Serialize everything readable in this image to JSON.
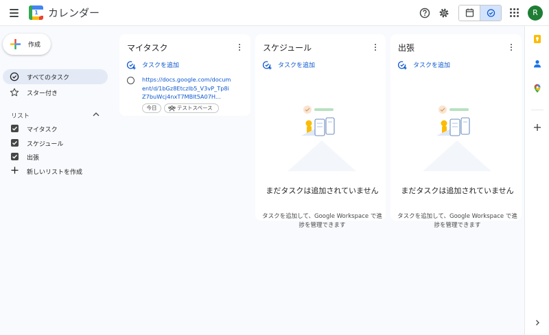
{
  "header": {
    "app_title": "カレンダー",
    "logo_day": "1",
    "avatar_initial": "R",
    "icons": [
      "menu-icon",
      "help-icon",
      "gear-icon",
      "calendar-view-icon",
      "tasks-view-icon",
      "apps-grid-icon"
    ]
  },
  "sidebar": {
    "create_label": "作成",
    "nav": [
      {
        "label": "すべてのタスク",
        "icon": "check-circle-icon",
        "active": true
      },
      {
        "label": "スター付き",
        "icon": "star-icon",
        "active": false
      }
    ],
    "lists_header": "リスト",
    "lists": [
      {
        "label": "マイタスク",
        "checked": true
      },
      {
        "label": "スケジュール",
        "checked": true
      },
      {
        "label": "出張",
        "checked": true
      }
    ],
    "new_list_label": "新しいリストを作成"
  },
  "cards": [
    {
      "title": "マイタスク",
      "add_task_label": "タスクを追加",
      "task": {
        "text": "https://docs.google.com/document/d/1bGz8EtczIb5_V3vP_Tp8iZ7buWcj4nxT7MBlt5A07H...",
        "chip_today": "今日",
        "chip_space": "テストスペース"
      }
    },
    {
      "title": "スケジュール",
      "add_task_label": "タスクを追加",
      "empty_title": "まだタスクは追加されていません",
      "empty_sub": "タスクを追加して、Google Workspace で進捗を管理できます"
    },
    {
      "title": "出張",
      "add_task_label": "タスクを追加",
      "empty_title": "まだタスクは追加されていません",
      "empty_sub": "タスクを追加して、Google Workspace で進捗を管理できます"
    }
  ],
  "side_panel": {
    "icons": [
      "keep-icon",
      "contacts-icon",
      "maps-icon",
      "add-icon",
      "chevron-right-icon"
    ]
  },
  "colors": {
    "accent": "#0b57d0",
    "active_nav": "#e3eaf6",
    "avatar": "#1e7e34",
    "background": "#f8fafd"
  }
}
